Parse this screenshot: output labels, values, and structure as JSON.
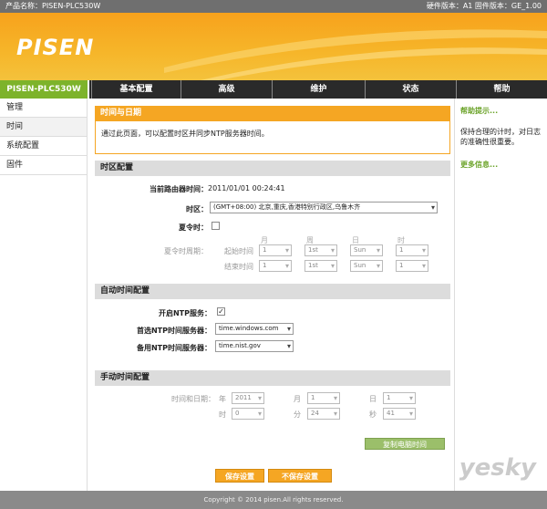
{
  "topbar": {
    "product": "产品名称：PISEN-PLC530W",
    "versions": "硬件版本：A1   固件版本：GE_1.00"
  },
  "brand": {
    "logo": "PISEN"
  },
  "nav": {
    "model": "PISEN-PLC530W",
    "tabs": [
      "基本配置",
      "高级",
      "维护",
      "状态",
      "帮助"
    ]
  },
  "sidebar": {
    "items": [
      "管理",
      "时间",
      "系统配置",
      "固件"
    ],
    "active": 1
  },
  "main": {
    "section_time": {
      "title": "时间与日期",
      "intro": "通过此页面，可以配置时区并同步NTP服务器时间。"
    },
    "section_tz": {
      "title": "时区配置",
      "current_label": "当前路由器时间：",
      "current_value": "2011/01/01 00:24:41",
      "tz_label": "时区：",
      "tz_value": "(GMT+08:00) 北京,重庆,香港特别行政区,乌鲁木齐",
      "dst_label": "夏令时：",
      "dst_period_label": "夏令时周期：",
      "col_month": "月",
      "col_week": "周",
      "col_day": "日",
      "col_hour": "时",
      "start_label": "起始时间",
      "end_label": "结束时间",
      "start": [
        "1",
        "1st",
        "Sun",
        "1"
      ],
      "end": [
        "1",
        "1st",
        "Sun",
        "1"
      ]
    },
    "section_ntp": {
      "title": "自动时间配置",
      "enable_label": "开启NTP服务：",
      "primary_label": "首选NTP时间服务器：",
      "primary_value": "time.windows.com",
      "backup_label": "备用NTP时间服务器：",
      "backup_value": "time.nist.gov"
    },
    "section_manual": {
      "title": "手动时间配置",
      "datetime_label": "时间和日期：",
      "year_l": "年",
      "month_l": "月",
      "day_l": "日",
      "hour_l": "时",
      "min_l": "分",
      "sec_l": "秒",
      "year": "2011",
      "month": "1",
      "day": "1",
      "hour": "0",
      "min": "24",
      "sec": "41",
      "copy_btn": "复制电脑时间"
    },
    "save_btn": "保存设置",
    "cancel_btn": "不保存设置"
  },
  "help": {
    "title": "帮助提示...",
    "text": "保持合理的计时，对日志的准确性很重要。",
    "more": "更多信息..."
  },
  "footer": "Copyright © 2014   pisen.All rights reserved.",
  "watermark": "yesky",
  "colors": {
    "accent": "#f5a623",
    "nav_green": "#7db32b",
    "help_green": "#6ba329"
  }
}
